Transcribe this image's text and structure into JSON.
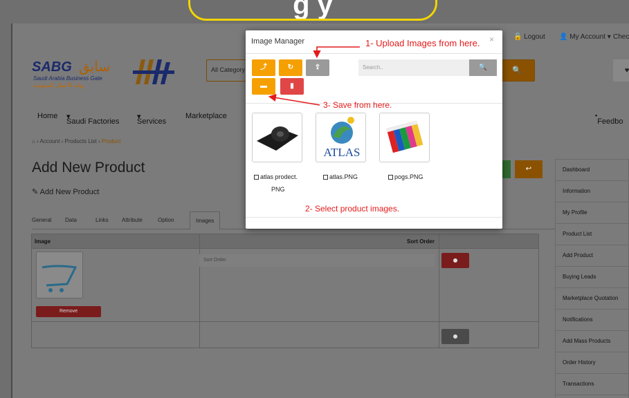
{
  "top_bubble": {
    "text": "g                   y     "
  },
  "topbar": {
    "logout": "Logout",
    "my_account": "My Account",
    "checkout": "Chec"
  },
  "logo": {
    "brand": "SABG",
    "arabic": "سابق",
    "tagline_en": "Saudi Arabia Business Gate",
    "tagline_ar": "بوابة الأعمال السعودية"
  },
  "search": {
    "category": "All Category",
    "button_icon": "search-icon"
  },
  "nav": {
    "items": [
      "Home",
      "Saudi Factories",
      "Services",
      "Marketplace"
    ],
    "feedback": "Feedbo"
  },
  "breadcrumb": {
    "account": "Account",
    "products_list": "Products List",
    "product": "Product"
  },
  "page": {
    "title": "Add New Product",
    "subtitle": "Add New Product"
  },
  "tabs": [
    "General",
    "Data",
    "Links",
    "Attribute",
    "Option",
    "Images"
  ],
  "table": {
    "col_image": "Image",
    "col_sort": "Sort Order",
    "sort_placeholder": "Sort Order",
    "remove_label": "Remove"
  },
  "sidebar": {
    "items": [
      "Dashboard",
      "Information",
      "My Profile",
      "Product List",
      "Add Product",
      "Buying Leads",
      "Marketplace Quotation",
      "Notifications",
      "Add Mass Products",
      "Order History",
      "Transactions"
    ]
  },
  "modal": {
    "title": "Image Manager",
    "close": "×",
    "search_placeholder": "Search..",
    "images": [
      {
        "label_line1": "atlas prodect.",
        "label_line2": "PNG"
      },
      {
        "label_line1": "atlas.PNG",
        "label_line2": ""
      },
      {
        "label_line1": "pogs.PNG",
        "label_line2": ""
      }
    ],
    "atlas_logo_text": "ATLAS"
  },
  "annotations": {
    "upload": "1- Upload Images from here.",
    "select": "2- Select product images.",
    "save": "3- Save from here."
  },
  "colors": {
    "orange": "#f5a000",
    "red": "#e04646",
    "annotation": "#e41a1a",
    "bubble_border": "#f2d500"
  }
}
